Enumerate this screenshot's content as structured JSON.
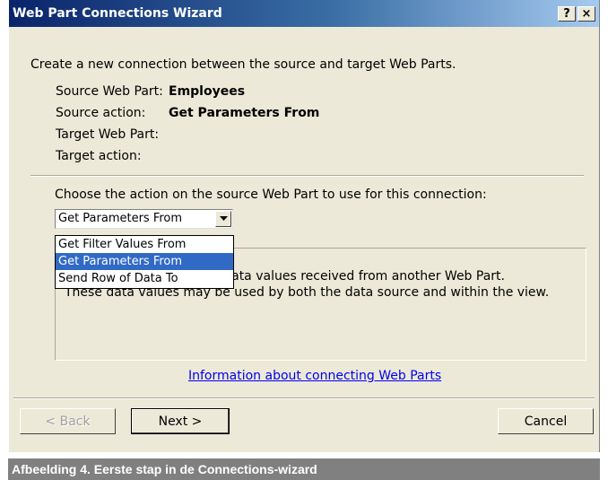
{
  "dialog": {
    "title": "Web Part Connections Wizard",
    "help_btn": "?",
    "close_btn": "×",
    "intro": "Create a new connection between the source and target Web Parts.",
    "info": {
      "source_web_part_label": "Source Web Part:",
      "source_web_part_value": "Employees",
      "source_action_label": "Source action:",
      "source_action_value": "Get Parameters From",
      "target_web_part_label": "Target Web Part:",
      "target_action_label": "Target action:"
    },
    "choose_label": "Choose the action on the source Web Part to use for this connection:",
    "select": {
      "value": "Get Parameters From",
      "options": [
        "Get Filter Values From",
        "Get Parameters From",
        "Send Row of Data To"
      ],
      "highlighted_index": 1
    },
    "description": {
      "line1_visible": "d on data values received from another Web Part.",
      "line2_visible": "These data values may be used by both the data source and within the view."
    },
    "info_link": "Information about connecting Web Parts",
    "buttons": {
      "back": "< Back",
      "next": "Next >",
      "cancel": "Cancel"
    }
  },
  "caption": "Afbeelding 4. Eerste stap in de Connections-wizard",
  "colors": {
    "titlebar_start": "#0a246a",
    "titlebar_end": "#a6caf0",
    "dialog_bg": "#ece9d8",
    "selection": "#316ac5",
    "link": "#0000ee",
    "caption_bg": "#808080"
  }
}
